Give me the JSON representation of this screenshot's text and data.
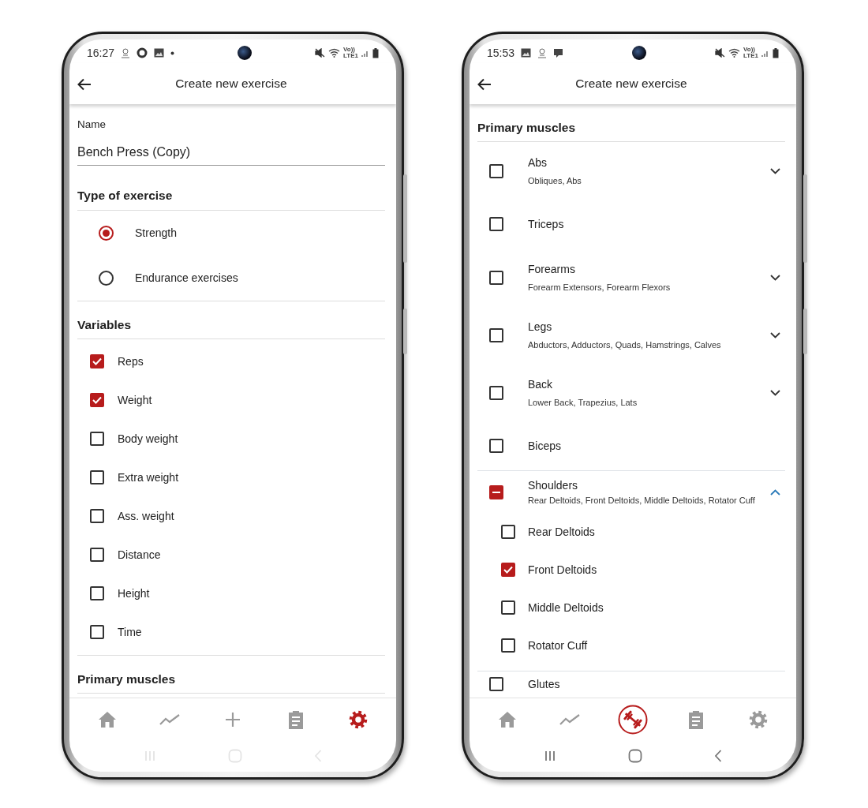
{
  "phones": [
    {
      "status_bar": {
        "time": "16:27",
        "network": [
          "Vo))",
          "LTE1"
        ]
      },
      "title": "Create new exercise",
      "sections": [
        {
          "kind": "field",
          "label": "Name",
          "value": "Bench Press (Copy)"
        },
        {
          "kind": "radios",
          "heading": "Type of exercise",
          "options": [
            {
              "label": "Strength",
              "selected": true
            },
            {
              "label": "Endurance exercises",
              "selected": false
            }
          ]
        },
        {
          "kind": "checks",
          "heading": "Variables",
          "items": [
            {
              "label": "Reps",
              "checked": true
            },
            {
              "label": "Weight",
              "checked": true
            },
            {
              "label": "Body weight",
              "checked": false
            },
            {
              "label": "Extra weight",
              "checked": false
            },
            {
              "label": "Ass. weight",
              "checked": false
            },
            {
              "label": "Distance",
              "checked": false
            },
            {
              "label": "Height",
              "checked": false
            },
            {
              "label": "Time",
              "checked": false
            }
          ]
        },
        {
          "kind": "heading",
          "heading": "Primary muscles"
        }
      ],
      "nav": [
        {
          "kind": "home",
          "selected": false
        },
        {
          "kind": "chart",
          "selected": false
        },
        {
          "kind": "plus",
          "selected": false
        },
        {
          "kind": "clipboard",
          "selected": false
        },
        {
          "kind": "gear",
          "selected": true
        }
      ],
      "system_nav_dimmed": true
    },
    {
      "status_bar": {
        "time": "15:53",
        "network": [
          "Vo))",
          "LTE1"
        ]
      },
      "title": "Create new exercise",
      "sections": [
        {
          "kind": "muscles",
          "heading": "Primary muscles",
          "items": [
            {
              "kind": "group",
              "label": "Abs",
              "detail": "Obliques, Abs",
              "checked": false,
              "indeterminate": false,
              "expanded": false
            },
            {
              "kind": "single",
              "label": "Triceps",
              "checked": false,
              "indeterminate": false
            },
            {
              "kind": "group",
              "label": "Forearms",
              "detail": "Forearm Extensors, Forearm Flexors",
              "checked": false,
              "indeterminate": false,
              "expanded": false
            },
            {
              "kind": "group",
              "label": "Legs",
              "detail": "Abductors, Adductors, Quads, Hamstrings, Calves",
              "checked": false,
              "indeterminate": false,
              "expanded": false
            },
            {
              "kind": "group",
              "label": "Back",
              "detail": "Lower Back, Trapezius, Lats",
              "checked": false,
              "indeterminate": false,
              "expanded": false
            },
            {
              "kind": "single",
              "label": "Biceps",
              "checked": false,
              "indeterminate": false
            },
            {
              "kind": "group",
              "label": "Shoulders",
              "detail": "Rear Deltoids, Front Deltoids, Middle Deltoids, Rotator Cuff",
              "checked": false,
              "indeterminate": true,
              "expanded": true,
              "children": [
                {
                  "label": "Rear Deltoids",
                  "checked": false
                },
                {
                  "label": "Front Deltoids",
                  "checked": true
                },
                {
                  "label": "Middle Deltoids",
                  "checked": false
                },
                {
                  "label": "Rotator Cuff",
                  "checked": false
                }
              ]
            },
            {
              "kind": "single",
              "label": "Glutes",
              "checked": false,
              "indeterminate": false
            }
          ]
        }
      ],
      "nav": [
        {
          "kind": "home",
          "selected": false
        },
        {
          "kind": "chart",
          "selected": false
        },
        {
          "kind": "barbell",
          "selected": true
        },
        {
          "kind": "clipboard",
          "selected": false
        },
        {
          "kind": "gear",
          "selected": false
        }
      ],
      "system_nav_dimmed": false
    }
  ]
}
